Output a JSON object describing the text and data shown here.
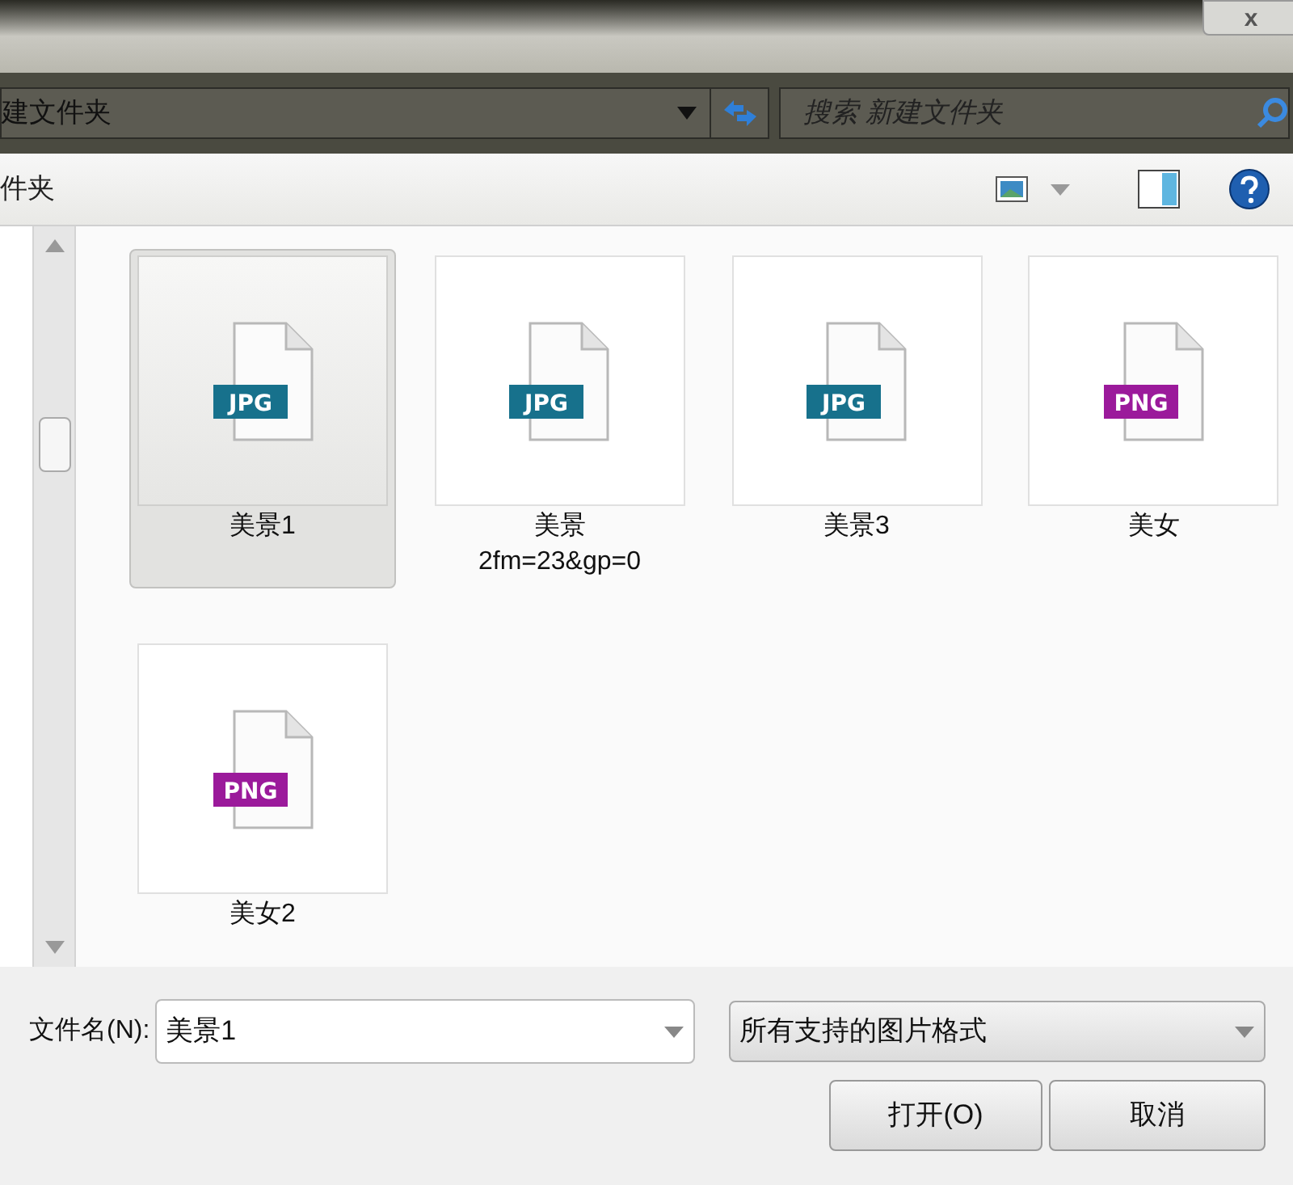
{
  "title_bar": {
    "close": "x"
  },
  "address_bar": {
    "path": "建文件夹",
    "search_placeholder": "搜索 新建文件夹"
  },
  "toolbar": {
    "label": "件夹"
  },
  "files": [
    {
      "name": "美景1",
      "type": "JPG",
      "selected": true
    },
    {
      "name": "美景\n2fm=23&gp=0",
      "type": "JPG",
      "selected": false
    },
    {
      "name": "美景3",
      "type": "JPG",
      "selected": false
    },
    {
      "name": "美女",
      "type": "PNG",
      "selected": false
    },
    {
      "name": "美女2",
      "type": "PNG",
      "selected": false
    }
  ],
  "footer": {
    "filename_label": "文件名(N):",
    "filename_value": "美景1",
    "filter": "所有支持的图片格式",
    "open_button": "打开(O)",
    "cancel_button": "取消"
  }
}
